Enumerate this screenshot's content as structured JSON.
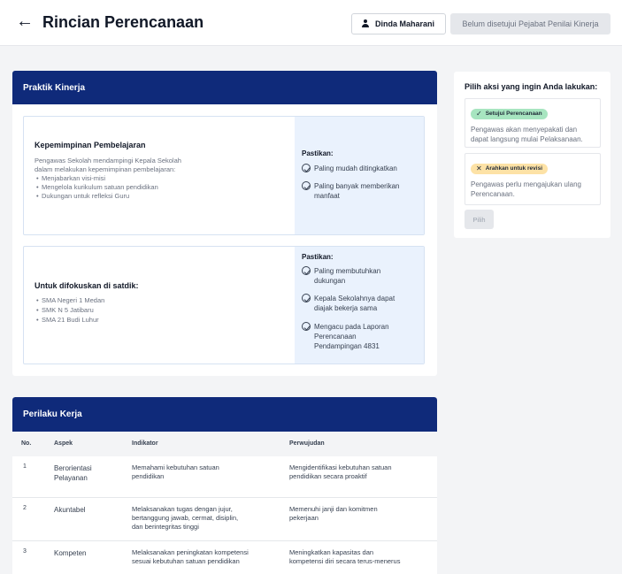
{
  "header": {
    "back_icon": "arrow-left-icon",
    "title": "Rincian Perencanaan",
    "user_name": "Dinda Maharani",
    "status": "Belum disetujui Pejabat Penilai Kinerja"
  },
  "praktik_kinerja": {
    "title": "Praktik Kinerja",
    "box1": {
      "heading": "Kepemimpinan Pembelajaran",
      "desc_line1": "Pengawas Sekolah mendampingi Kepala Sekolah",
      "desc_line2": "dalam melakukan kepemimpinan pembelajaran:",
      "bullets": [
        "Menjabarkan visi-misi",
        "Mengelola kurikulum satuan pendidikan",
        "Dukungan untuk refleksi Guru"
      ],
      "pastikan_label": "Pastikan:",
      "checks": [
        {
          "l1": "Paling mudah ditingkatkan",
          "l2": ""
        },
        {
          "l1": "Paling banyak memberikan",
          "l2": "manfaat"
        }
      ]
    },
    "box2": {
      "heading": "Untuk difokuskan di satdik:",
      "bullets": [
        "SMA Negeri 1 Medan",
        "SMK N 5 Jatibaru",
        "SMA 21 Budi Luhur"
      ],
      "pastikan_label": "Pastikan:",
      "checks": [
        {
          "l1": "Paling membutuhkan",
          "l2": "dukungan",
          "l3": ""
        },
        {
          "l1": "Kepala Sekolahnya dapat",
          "l2": "diajak bekerja sama",
          "l3": ""
        },
        {
          "l1": "Mengacu pada Laporan",
          "l2": "Perencanaan",
          "l3": "Pendampingan 4831"
        }
      ]
    }
  },
  "aksi": {
    "title": "Pilih aksi yang ingin Anda lakukan:",
    "option1": {
      "badge": "Setujui Perencanaan",
      "desc1": "Pengawas akan menyepakati dan",
      "desc2": "dapat langsung mulai Pelaksanaan."
    },
    "option2": {
      "badge": "Arahkan untuk revisi",
      "desc1": "Pengawas perlu mengajukan ulang",
      "desc2": "Perencanaan."
    },
    "button": "Pilih"
  },
  "perilaku_kerja": {
    "title": "Perilaku Kerja",
    "headers": [
      "No.",
      "Aspek",
      "Indikator",
      "Perwujudan"
    ],
    "rows": [
      {
        "no": "1",
        "aspek1": "Berorientasi",
        "aspek2": "Pelayanan",
        "ind1": "Memahami kebutuhan satuan",
        "ind2": "pendidikan",
        "ind3": "",
        "per1": "Mengidentifikasi kebutuhan satuan",
        "per2": "pendidikan secara proaktif"
      },
      {
        "no": "2",
        "aspek1": "Akuntabel",
        "aspek2": "",
        "ind1": "Melaksanakan tugas dengan jujur,",
        "ind2": "bertanggung jawab, cermat, disiplin,",
        "ind3": "dan berintegritas tinggi",
        "per1": "Memenuhi janji dan komitmen",
        "per2": "pekerjaan"
      },
      {
        "no": "3",
        "aspek1": "Kompeten",
        "aspek2": "",
        "ind1": "Melaksanakan peningkatan kompetensi",
        "ind2": "sesuai kebutuhan satuan pendidikan",
        "ind3": "",
        "per1": "Meningkatkan kapasitas dan",
        "per2": "kompetensi diri secara terus-menerus"
      }
    ]
  }
}
